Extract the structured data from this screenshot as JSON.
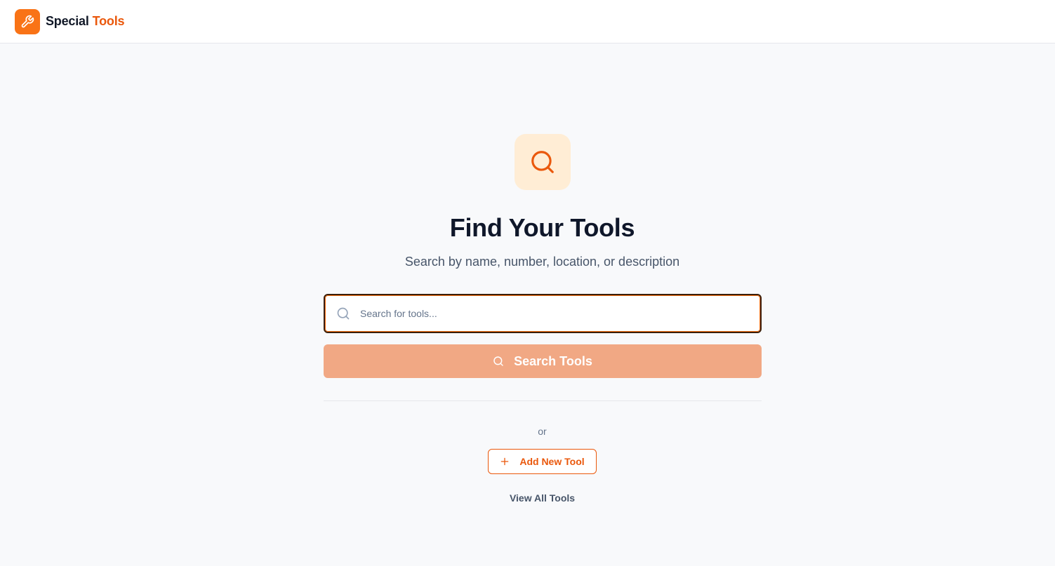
{
  "header": {
    "brand_part1": "Special",
    "brand_part2": "Tools",
    "logo_icon": "wrench-icon"
  },
  "hero": {
    "icon": "search-icon",
    "title": "Find Your Tools",
    "subtitle": "Search by name, number, location, or description"
  },
  "search": {
    "placeholder": "Search for tools...",
    "value": "",
    "button_label": "Search Tools"
  },
  "alt": {
    "or_text": "or",
    "add_label": "Add New Tool",
    "view_all_label": "View All Tools"
  },
  "colors": {
    "accent": "#f97316",
    "accent_dark": "#ea580c",
    "accent_light": "#ffedd5",
    "button_disabled": "#f1a884",
    "background": "#f8f9fb"
  }
}
